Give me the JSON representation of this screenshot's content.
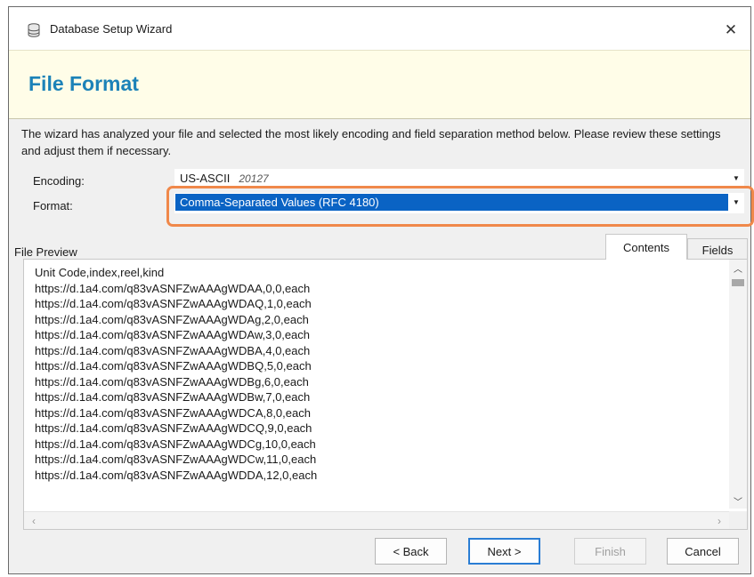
{
  "window": {
    "title": "Database Setup Wizard",
    "close_glyph": "✕",
    "icon": "database-icon"
  },
  "header": {
    "title": "File Format"
  },
  "description": "The wizard has analyzed your file and selected the most likely encoding and field separation method below. Please review these settings and adjust them if necessary.",
  "encoding": {
    "label": "Encoding:",
    "value": "US-ASCII",
    "code": "20127"
  },
  "format": {
    "label": "Format:",
    "value": "Comma-Separated Values (RFC 4180)"
  },
  "preview": {
    "label": "File Preview",
    "tabs": [
      {
        "label": "Contents",
        "active": true
      },
      {
        "label": "Fields",
        "active": false
      }
    ],
    "lines": [
      "Unit Code,index,reel,kind",
      "https://d.1a4.com/q83vASNFZwAAAgWDAA,0,0,each",
      "https://d.1a4.com/q83vASNFZwAAAgWDAQ,1,0,each",
      "https://d.1a4.com/q83vASNFZwAAAgWDAg,2,0,each",
      "https://d.1a4.com/q83vASNFZwAAAgWDAw,3,0,each",
      "https://d.1a4.com/q83vASNFZwAAAgWDBA,4,0,each",
      "https://d.1a4.com/q83vASNFZwAAAgWDBQ,5,0,each",
      "https://d.1a4.com/q83vASNFZwAAAgWDBg,6,0,each",
      "https://d.1a4.com/q83vASNFZwAAAgWDBw,7,0,each",
      "https://d.1a4.com/q83vASNFZwAAAgWDCA,8,0,each",
      "https://d.1a4.com/q83vASNFZwAAAgWDCQ,9,0,each",
      "https://d.1a4.com/q83vASNFZwAAAgWDCg,10,0,each",
      "https://d.1a4.com/q83vASNFZwAAAgWDCw,11,0,each",
      "https://d.1a4.com/q83vASNFZwAAAgWDDA,12,0,each"
    ]
  },
  "buttons": {
    "back": "< Back",
    "next": "Next >",
    "finish": "Finish",
    "cancel": "Cancel"
  },
  "colors": {
    "title_accent": "#1c82b8",
    "header_bg": "#fffde8",
    "selection": "#0a63c4",
    "highlight_outline": "#f0884a"
  }
}
